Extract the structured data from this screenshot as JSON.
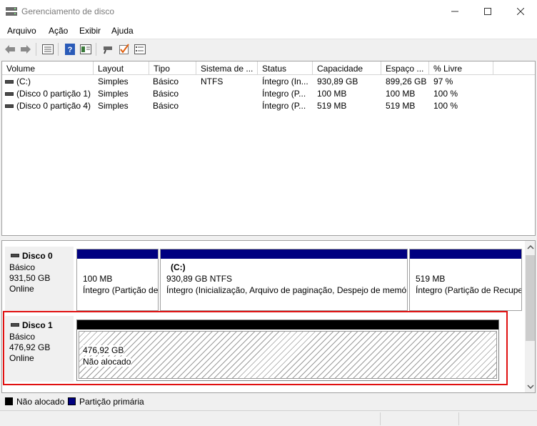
{
  "window": {
    "title": "Gerenciamento de disco"
  },
  "menu": [
    "Arquivo",
    "Ação",
    "Exibir",
    "Ajuda"
  ],
  "toolbar": [
    "back-icon",
    "forward-icon",
    "details-icon",
    "help-icon",
    "properties-icon",
    "connect-icon",
    "check-icon",
    "list-icon"
  ],
  "columns": [
    "Volume",
    "Layout",
    "Tipo",
    "Sistema de ...",
    "Status",
    "Capacidade",
    "Espaço ...",
    "% Livre"
  ],
  "volumes": [
    [
      "(C:)",
      "Simples",
      "Básico",
      "NTFS",
      "Íntegro (In...",
      "930,89 GB",
      "899,26 GB",
      "97 %"
    ],
    [
      "(Disco 0 partição 1)",
      "Simples",
      "Básico",
      "",
      "Íntegro (P...",
      "100 MB",
      "100 MB",
      "100 %"
    ],
    [
      "(Disco 0 partição 4)",
      "Simples",
      "Básico",
      "",
      "Íntegro (P...",
      "519 MB",
      "519 MB",
      "100 %"
    ]
  ],
  "disks": [
    {
      "name": "Disco 0",
      "type": "Básico",
      "size": "931,50 GB",
      "state": "Online",
      "partitions": [
        {
          "label": "",
          "size": "100 MB",
          "status": "Íntegro (Partição de Sistema EFI)"
        },
        {
          "label": "(C:)",
          "size": "930,89 GB NTFS",
          "status": "Íntegro (Inicialização, Arquivo de paginação, Despejo de memória, Partição Primária)"
        },
        {
          "label": "",
          "size": "519 MB",
          "status": "Íntegro (Partição de Recuperação)"
        }
      ]
    },
    {
      "name": "Disco 1",
      "type": "Básico",
      "size": "476,92 GB",
      "state": "Online",
      "partitions": [
        {
          "size": "476,92 GB",
          "status": "Não alocado"
        }
      ]
    }
  ],
  "legend": [
    {
      "label": "Não alocado",
      "color": "#000000"
    },
    {
      "label": "Partição primária",
      "color": "#000080"
    }
  ]
}
